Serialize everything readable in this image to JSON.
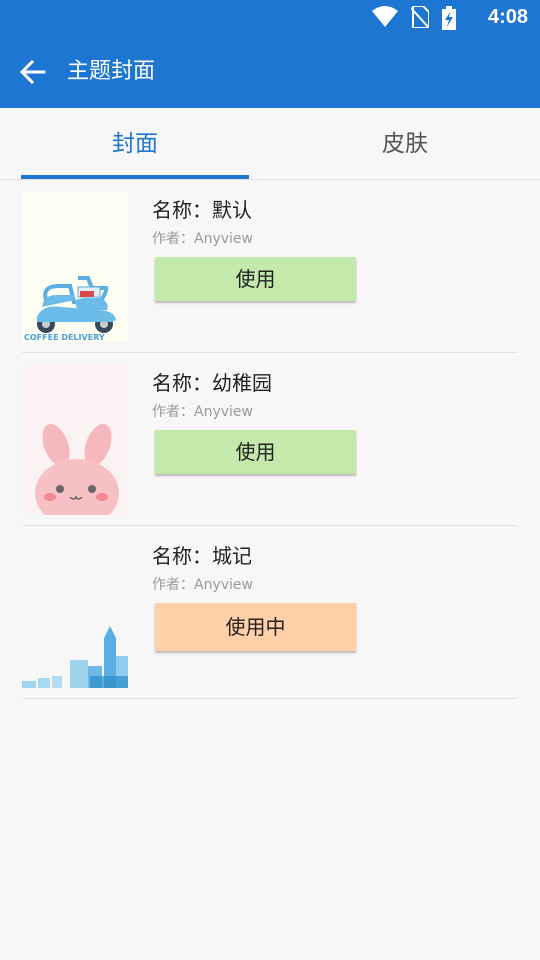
{
  "status_bar": {
    "time": "4:08",
    "icons": [
      "wifi-icon",
      "no-sim-icon",
      "battery-charging-icon"
    ]
  },
  "app_bar": {
    "title": "主题封面",
    "back_icon": "arrow-back-icon"
  },
  "tabs": [
    {
      "label": "封面",
      "active": true
    },
    {
      "label": "皮肤",
      "active": false
    }
  ],
  "items": [
    {
      "name": "名称：默认",
      "author": "作者：Anyview",
      "button": "使用",
      "state": "available",
      "thumb_text": "COFFEE DELIVERY"
    },
    {
      "name": "名称：幼稚园",
      "author": "作者：Anyview",
      "button": "使用",
      "state": "available"
    },
    {
      "name": "名称：城记",
      "author": "作者：Anyview",
      "button": "使用中",
      "state": "in-use"
    }
  ],
  "colors": {
    "primary": "#1e76d3",
    "use_button": "#c3e9ab",
    "in_use_button": "#ffcfa8",
    "background": "#f7f7f7"
  }
}
